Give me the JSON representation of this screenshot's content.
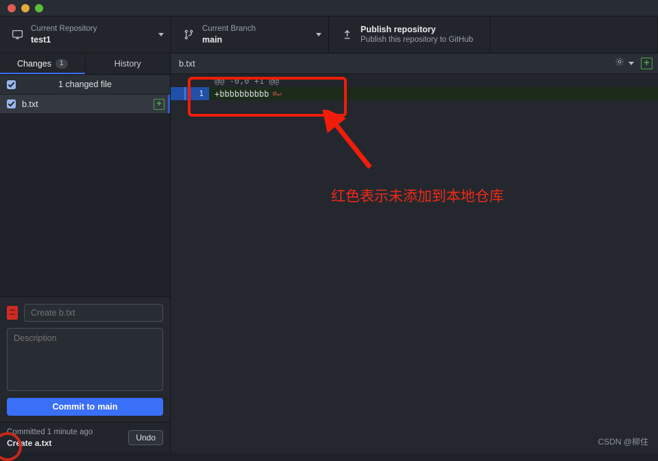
{
  "window": {
    "traffic_lights": [
      "close",
      "minimize",
      "maximize"
    ]
  },
  "toolbar": {
    "repository": {
      "label": "Current Repository",
      "value": "test1",
      "icon": "desktop-icon"
    },
    "branch": {
      "label": "Current Branch",
      "value": "main",
      "icon": "git-branch-icon"
    },
    "publish": {
      "title": "Publish repository",
      "subtitle": "Publish this repository to GitHub",
      "icon": "upload-icon"
    }
  },
  "sidebar": {
    "tabs": [
      {
        "label": "Changes",
        "badge": "1",
        "active": true
      },
      {
        "label": "History",
        "badge": "",
        "active": false
      }
    ],
    "changed_header": "1 changed file",
    "files": [
      {
        "name": "b.txt",
        "status": "+",
        "checked": true
      }
    ],
    "commit": {
      "summary_placeholder": "Create b.txt",
      "summary_value": "",
      "description_placeholder": "Description",
      "description_value": "",
      "button_prefix": "Commit to",
      "button_branch": "main"
    },
    "undo": {
      "line1": "Committed 1 minute ago",
      "line2": "Create a.txt",
      "button": "Undo"
    }
  },
  "diff": {
    "filename": "b.txt",
    "gear_icon": "gear-icon",
    "plus_icon": "plus-icon",
    "rows": [
      {
        "type": "hunk",
        "lineno": "",
        "text": "@@ -0,0 +1 @@",
        "invisible": ""
      },
      {
        "type": "added",
        "lineno": "1",
        "text": "+bbbbbbbbbb",
        "invisible": "⊘↵"
      }
    ]
  },
  "annotations": {
    "note": "红色表示未添加到本地仓库",
    "color": "#ef2a17"
  },
  "watermark": "CSDN @柳住",
  "colors": {
    "accent_blue": "#3a6ff7",
    "added_green": "#49aa4a",
    "annotation_red": "#ef2a17",
    "diff_added_bg": "#1c2b1a",
    "selected_blue": "#2050a8"
  }
}
